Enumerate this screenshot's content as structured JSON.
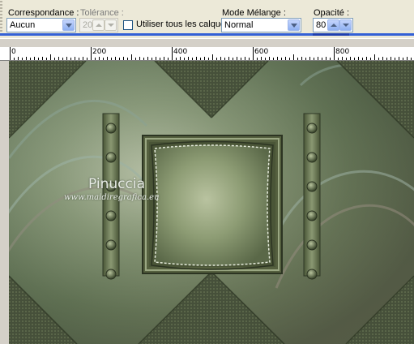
{
  "toolbar": {
    "correspondance": {
      "label": "Correspondance :",
      "value": "Aucun"
    },
    "tolerance": {
      "label": "Tolérance :",
      "value": "20"
    },
    "all_layers": {
      "label": "Utiliser tous les calques",
      "checked": false
    },
    "blend_mode": {
      "label": "Mode Mélange :",
      "value": "Normal"
    },
    "opacity": {
      "label": "Opacité :",
      "value": "80"
    }
  },
  "ruler": {
    "ticks": [
      "0",
      "200",
      "400",
      "600",
      "800"
    ]
  },
  "watermark": {
    "line1": "Pinuccia",
    "line2": "www.maidiregrafica.eu"
  },
  "colors": {
    "toolbar_bg": "#ece9d8",
    "accent_blue": "#3360d6",
    "frame_green": "#6f7d58",
    "canvas_dark": "#3b4430"
  }
}
